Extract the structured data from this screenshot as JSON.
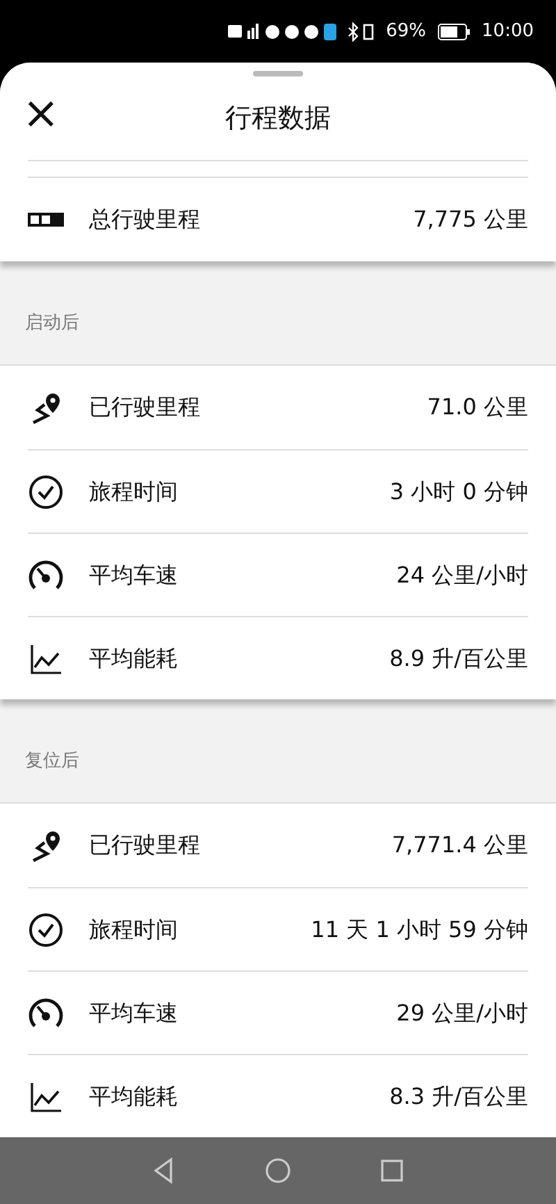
{
  "status_bar": {
    "battery": "69%",
    "time": "10:00"
  },
  "header": {
    "close": "×",
    "title": "行程数据"
  },
  "total": {
    "label": "总行驶里程",
    "value": "7,775 公里"
  },
  "sections": [
    {
      "title": "启动后",
      "rows": [
        {
          "kind": "distance",
          "label": "已行驶里程",
          "value": "71.0 公里"
        },
        {
          "kind": "time",
          "label": "旅程时间",
          "value": "3 小时 0 分钟"
        },
        {
          "kind": "speed",
          "label": "平均车速",
          "value": "24 公里/小时"
        },
        {
          "kind": "consumption",
          "label": "平均能耗",
          "value": "8.9 升/百公里"
        }
      ]
    },
    {
      "title": "复位后",
      "rows": [
        {
          "kind": "distance",
          "label": "已行驶里程",
          "value": "7,771.4 公里"
        },
        {
          "kind": "time",
          "label": "旅程时间",
          "value": "11 天 1 小时 59 分钟"
        },
        {
          "kind": "speed",
          "label": "平均车速",
          "value": "29 公里/小时"
        },
        {
          "kind": "consumption",
          "label": "平均能耗",
          "value": "8.3 升/百公里"
        }
      ]
    }
  ]
}
